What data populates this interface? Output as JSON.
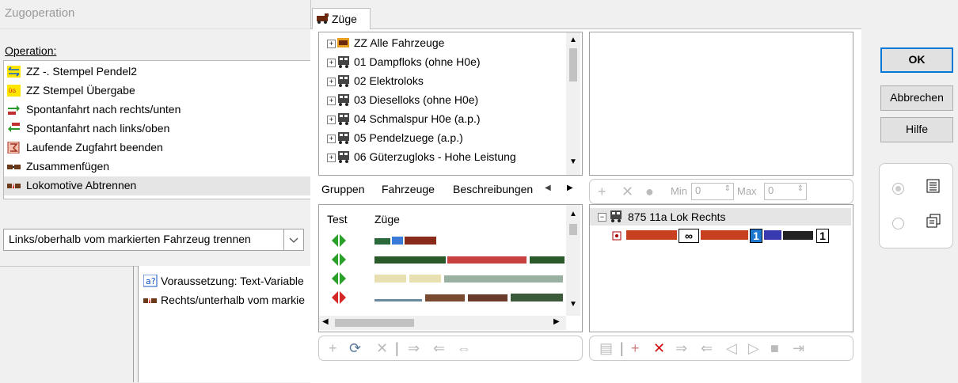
{
  "left_dialog": {
    "title": "Zugoperation",
    "operation_label": "Operation:",
    "operations": [
      {
        "label": "ZZ -. Stempel Pendel2",
        "icon": "pendulum-stamp-icon"
      },
      {
        "label": "ZZ Stempel Übergabe",
        "icon": "handover-stamp-icon"
      },
      {
        "label": "Spontanfahrt nach rechts/unten",
        "icon": "arrow-right-down-icon"
      },
      {
        "label": "Spontanfahrt nach links/oben",
        "icon": "arrow-left-up-icon"
      },
      {
        "label": "Laufende Zugfahrt beenden",
        "icon": "stop-train-icon"
      },
      {
        "label": "Zusammenfügen",
        "icon": "couple-icon"
      },
      {
        "label": "Lokomotive Abtrennen",
        "icon": "uncouple-icon"
      }
    ],
    "selected_operation": 6,
    "split_select_value": "Links/oberhalb vom markierten Fahrzeug trennen"
  },
  "background_list": [
    {
      "label": "Voraussetzung: Text-Variable",
      "icon": "condition-icon"
    },
    {
      "label": "Rechts/unterhalb vom markie",
      "icon": "uncouple-icon"
    }
  ],
  "main": {
    "tab_label": "Züge",
    "tree": [
      {
        "label": "ZZ Alle Fahrzeuge",
        "icon": "all-vehicles-icon"
      },
      {
        "label": "01 Dampfloks (ohne H0e)",
        "icon": "train-group-icon"
      },
      {
        "label": "02 Elektroloks",
        "icon": "train-group-icon"
      },
      {
        "label": "03 Dieselloks (ohne H0e)",
        "icon": "train-group-icon"
      },
      {
        "label": "04 Schmalspur H0e (a.p.)",
        "icon": "train-group-icon"
      },
      {
        "label": "05 Pendelzuege (a.p.)",
        "icon": "train-group-icon"
      },
      {
        "label": "06 Güterzugloks - Hohe Leistung",
        "icon": "train-group-icon"
      }
    ],
    "subtabs": [
      "Gruppen",
      "Fahrzeuge",
      "Beschreibungen"
    ],
    "minmax": {
      "min_label": "Min",
      "min_value": "0",
      "max_label": "Max",
      "max_value": "0"
    },
    "tests_header": {
      "test": "Test",
      "zuege": "Züge"
    },
    "tests_rows": [
      {
        "status": "green"
      },
      {
        "status": "green"
      },
      {
        "status": "green"
      },
      {
        "status": "red"
      }
    ],
    "consist": {
      "title": "875 11a Lok Rechts",
      "count_1": "∞",
      "count_2": "1",
      "count_3": "1"
    }
  },
  "buttons": {
    "ok": "OK",
    "cancel": "Abbrechen",
    "help": "Hilfe"
  },
  "colors": {
    "accent": "#0078d7",
    "green_test": "#2ca02c",
    "red_test": "#d62728",
    "selection": "#e5e5e5"
  }
}
